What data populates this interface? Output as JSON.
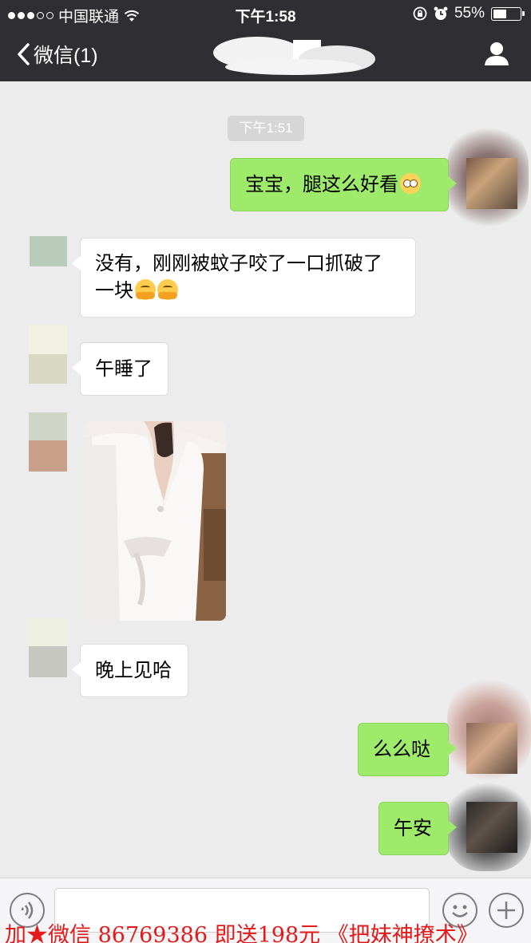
{
  "status_bar": {
    "carrier": "中国联通",
    "time": "下午1:58",
    "battery_percent": "55%",
    "battery_level": 0.55
  },
  "nav": {
    "back_label": "微信(1)"
  },
  "chat": {
    "timestamp": "下午1:51",
    "messages": [
      {
        "sender": "me",
        "text": "宝宝，腿这么好看",
        "emoji": "flushed-face"
      },
      {
        "sender": "them",
        "line1": "没有，刚刚被蚊子咬了一口抓破了",
        "line2": "一块",
        "emoji": "hugging-face"
      },
      {
        "sender": "them",
        "text": "午睡了"
      },
      {
        "sender": "them",
        "type": "image"
      },
      {
        "sender": "them",
        "text": "晚上见哈"
      },
      {
        "sender": "me",
        "text": "么么哒"
      },
      {
        "sender": "me",
        "text": "午安"
      }
    ]
  },
  "input_bar": {
    "placeholder": ""
  },
  "watermark": "加★微信 86769386 即送198元 《把妹神撩术》",
  "colors": {
    "header_bg": "#2f2f33",
    "chat_bg": "#ececec",
    "my_bubble": "#9eea6a",
    "their_bubble": "#ffffff",
    "watermark": "#e21a1a"
  }
}
